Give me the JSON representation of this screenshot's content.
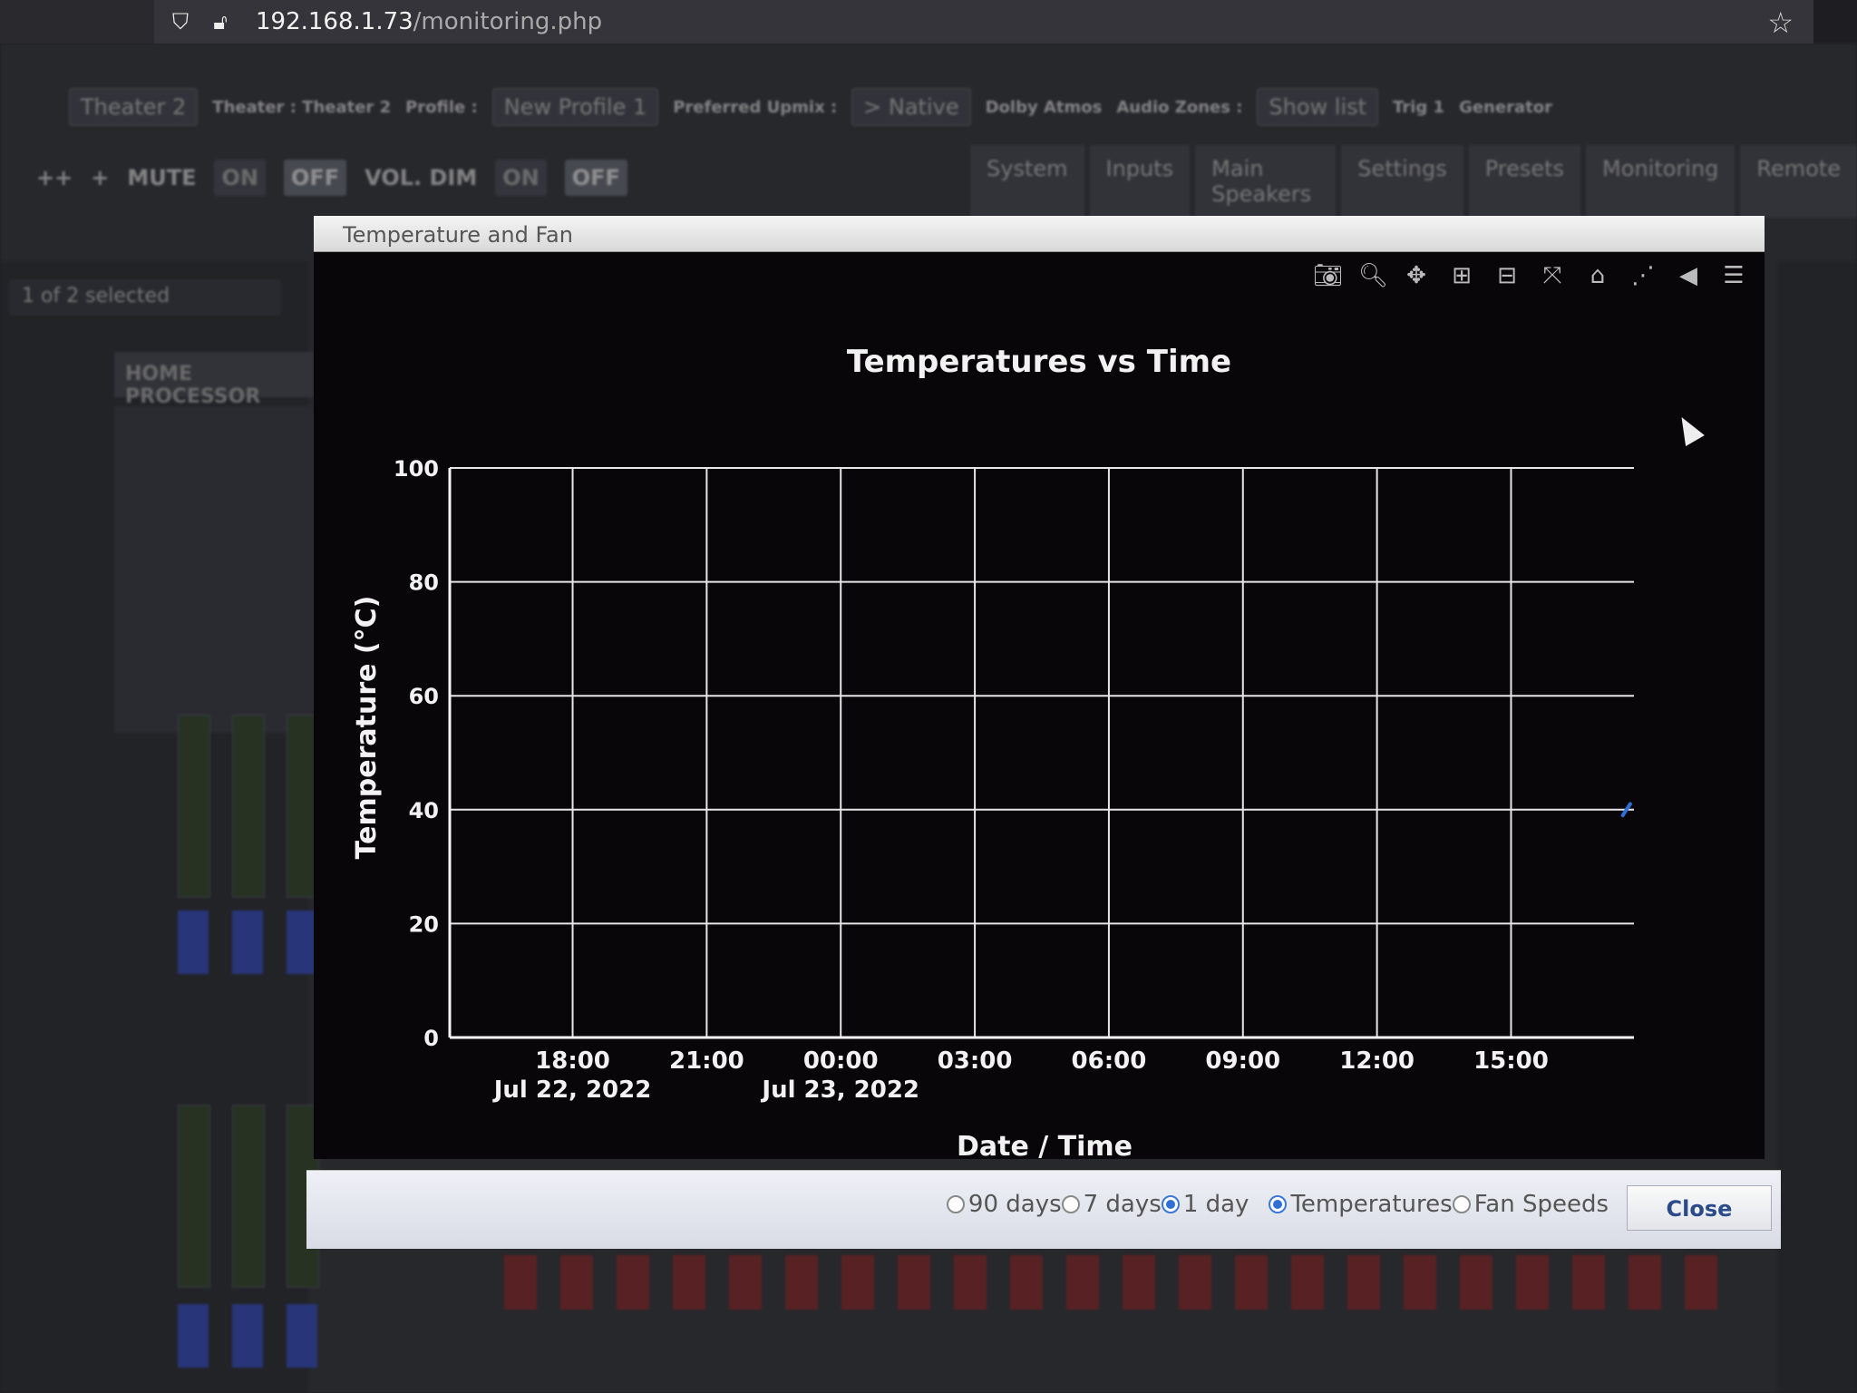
{
  "browser": {
    "url_host": "192.168.1.73",
    "url_path": "/monitoring.php"
  },
  "background": {
    "preset_value": "Theater 2",
    "theater_label": "Theater : Theater 2",
    "profile_label": "Profile :",
    "profile_value": "New Profile 1",
    "upmix_label": "Preferred Upmix :",
    "upmix_value": "> Native",
    "dolby_label": "Dolby Atmos",
    "zones_label": "Audio Zones :",
    "zones_value": "Show list",
    "trig_label": "Trig 1",
    "generator_label": "Generator",
    "mute_label": "MUTE",
    "on_label": "ON",
    "off_label": "OFF",
    "vol_dim_label": "VOL. DIM",
    "tabs": [
      "System",
      "Inputs",
      "Main Speakers",
      "Settings",
      "Presets",
      "Monitoring",
      "Remote"
    ],
    "selected_count": "1 of 2 selected",
    "home_processor": "HOME PROCESSOR"
  },
  "dialog": {
    "title": "Temperature and Fan",
    "range_options": [
      "90 days",
      "7 days",
      "1 day"
    ],
    "range_selected": "1 day",
    "metric_options": [
      "Temperatures",
      "Fan Speeds"
    ],
    "metric_selected": "Temperatures",
    "close_label": "Close",
    "toolbar_icons": [
      "camera-icon",
      "zoom-icon",
      "pan-icon",
      "zoom-in-icon",
      "zoom-out-icon",
      "autoscale-icon",
      "home-icon",
      "spike-lines-icon",
      "hover-closest-icon",
      "hover-compare-icon"
    ]
  },
  "chart_data": {
    "type": "line",
    "title": "Temperatures vs Time",
    "xlabel": "Date / Time",
    "ylabel": "Temperature (°C)",
    "ylim": [
      0,
      100
    ],
    "yticks": [
      0,
      20,
      40,
      60,
      80,
      100
    ],
    "xticks": [
      {
        "t": "2022-07-22 18:00",
        "label": "18:00",
        "sublabel": "Jul 22, 2022"
      },
      {
        "t": "2022-07-22 21:00",
        "label": "21:00",
        "sublabel": ""
      },
      {
        "t": "2022-07-23 00:00",
        "label": "00:00",
        "sublabel": "Jul 23, 2022"
      },
      {
        "t": "2022-07-23 03:00",
        "label": "03:00",
        "sublabel": ""
      },
      {
        "t": "2022-07-23 06:00",
        "label": "06:00",
        "sublabel": ""
      },
      {
        "t": "2022-07-23 09:00",
        "label": "09:00",
        "sublabel": ""
      },
      {
        "t": "2022-07-23 12:00",
        "label": "12:00",
        "sublabel": ""
      },
      {
        "t": "2022-07-23 15:00",
        "label": "15:00",
        "sublabel": ""
      }
    ],
    "xlim": [
      "2022-07-22 15:15",
      "2022-07-23 17:45"
    ],
    "grid": true,
    "series": [
      {
        "color": "#2e6fd8",
        "x": [
          "2022-07-23 17:30",
          "2022-07-23 17:40"
        ],
        "y": [
          39,
          41
        ]
      }
    ]
  }
}
